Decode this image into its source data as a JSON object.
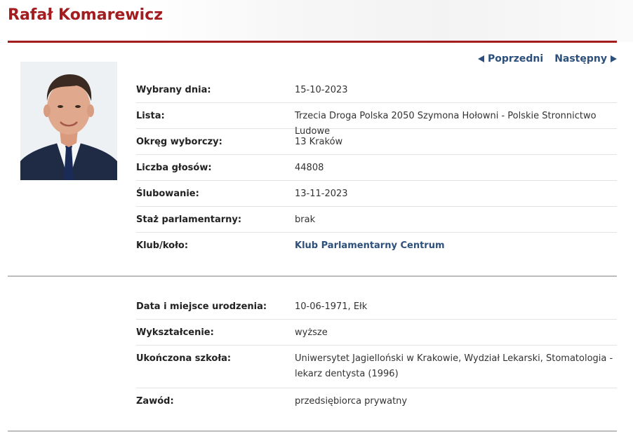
{
  "person": {
    "name": "Rafał Komarewicz"
  },
  "nav": {
    "prev_label": "Poprzedni",
    "next_label": "Następny"
  },
  "section1": {
    "rows": [
      {
        "label": "Wybrany dnia:",
        "value": "15-10-2023"
      },
      {
        "label": "Lista:",
        "value": "Trzecia Droga Polska 2050 Szymona Hołowni - Polskie Stronnictwo Ludowe"
      },
      {
        "label": "Okręg wyborczy:",
        "value": "13  Kraków"
      },
      {
        "label": "Liczba głosów:",
        "value": "44808"
      },
      {
        "label": "Ślubowanie:",
        "value": "13-11-2023"
      },
      {
        "label": "Staż parlamentarny:",
        "value": "brak"
      },
      {
        "label": "Klub/koło:",
        "value": "Klub Parlamentarny Centrum"
      }
    ]
  },
  "section2": {
    "rows": [
      {
        "label": "Data i miejsce urodzenia:",
        "value": "10-06-1971, Ełk"
      },
      {
        "label": "Wykształcenie:",
        "value": "wyższe"
      },
      {
        "label": "Ukończona szkoła:",
        "value": "Uniwersytet Jagielloński w Krakowie, Wydział Lekarski, Stomatologia - lekarz dentysta (1996)"
      },
      {
        "label": "Zawód:",
        "value": "przedsiębiorca prywatny"
      }
    ]
  },
  "colors": {
    "accent": "#a31c1f",
    "link": "#2c4f7c"
  }
}
